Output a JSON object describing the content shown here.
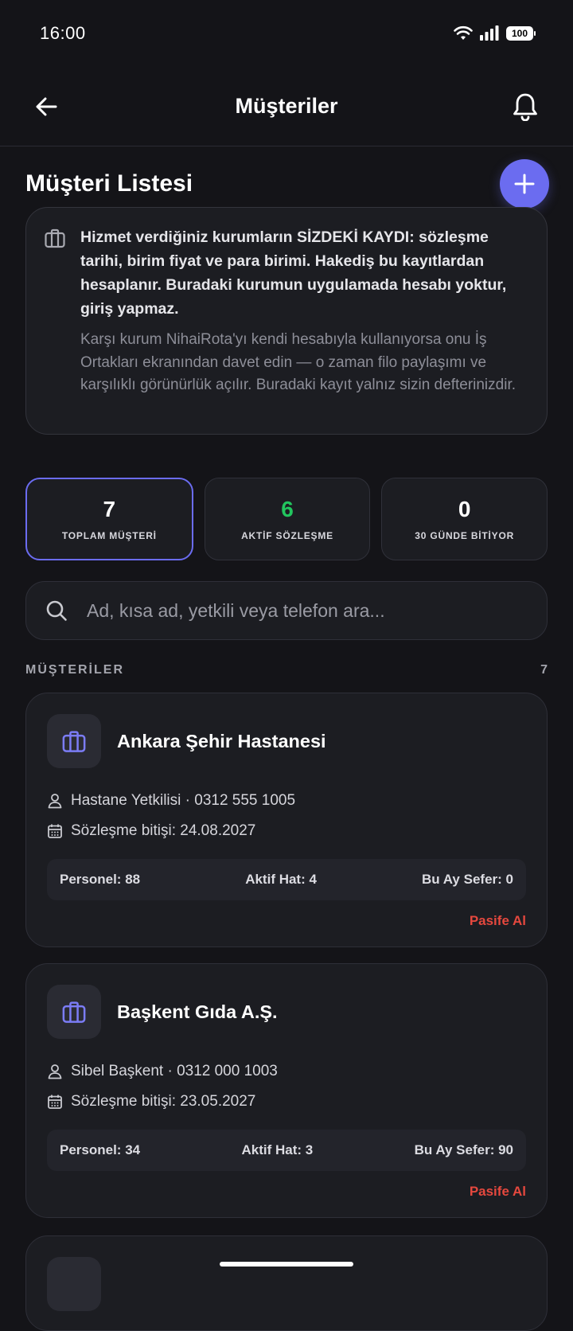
{
  "status_bar": {
    "time": "16:00",
    "battery": "100"
  },
  "app_bar": {
    "title": "Müşteriler"
  },
  "section": {
    "title": "Müşteri Listesi"
  },
  "info": {
    "main": "Hizmet verdiğiniz kurumların SİZDEKİ KAYDI: sözleşme tarihi, birim fiyat ve para birimi. Hakediş bu kayıtlardan hesaplanır. Buradaki kurumun uygulamada hesabı yoktur, giriş yapmaz.",
    "sub": "Karşı kurum NihaiRota'yı kendi hesabıyla kullanıyorsa onu İş Ortakları ekranından davet edin — o zaman filo paylaşımı ve karşılıklı görünürlük açılır. Buradaki kayıt yalnız sizin defterinizdir."
  },
  "stats": [
    {
      "value": "7",
      "label": "TOPLAM MÜŞTERİ",
      "color": "#ffffff"
    },
    {
      "value": "6",
      "label": "AKTİF SÖZLEŞME",
      "color": "#22c55e"
    },
    {
      "value": "0",
      "label": "30 GÜNDE BİTİYOR",
      "color": "#ffffff"
    }
  ],
  "search": {
    "placeholder": "Ad, kısa ad, yetkili veya telefon ara..."
  },
  "list": {
    "header": "MÜŞTERİLER",
    "count": "7"
  },
  "customers": [
    {
      "name": "Ankara Şehir Hastanesi",
      "contact": "Hastane Yetkilisi · 0312 555 1005",
      "contract": "Sözleşme bitişi: 24.08.2027",
      "personnel": "Personel: 88",
      "lines": "Aktif Hat: 4",
      "trips": "Bu Ay Sefer: 0",
      "action": "Pasife Al"
    },
    {
      "name": "Başkent Gıda A.Ş.",
      "contact": "Sibel Başkent · 0312 000 1003",
      "contract": "Sözleşme bitişi: 23.05.2027",
      "personnel": "Personel: 34",
      "lines": "Aktif Hat: 3",
      "trips": "Bu Ay Sefer: 90",
      "action": "Pasife Al"
    }
  ],
  "colors": {
    "accent": "#6b6cf0",
    "danger": "#e5483e",
    "success": "#22c55e",
    "background": "#141418",
    "card": "#1c1d22"
  }
}
